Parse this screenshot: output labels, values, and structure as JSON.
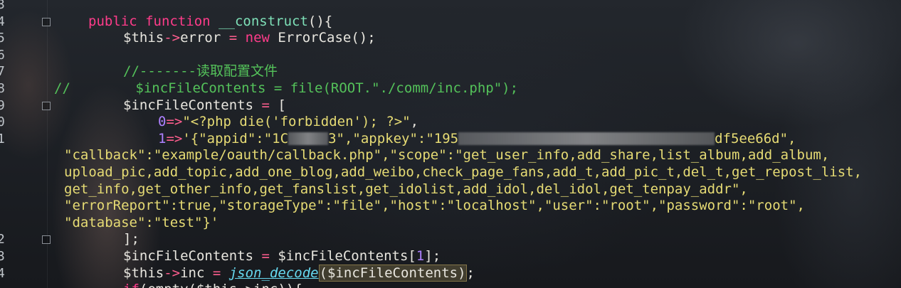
{
  "editor": {
    "lines": [
      {
        "no": "3",
        "parts": []
      },
      {
        "no": "4",
        "parts": [
          {
            "cls": "kw",
            "t": "public"
          },
          {
            "cls": "",
            "t": " "
          },
          {
            "cls": "kw",
            "t": "function"
          },
          {
            "cls": "",
            "t": " "
          },
          {
            "cls": "fn",
            "t": "__construct"
          },
          {
            "cls": "",
            "t": "(){"
          }
        ]
      },
      {
        "no": "5",
        "parts": [
          {
            "cls": "",
            "t": "$this"
          },
          {
            "cls": "op",
            "t": "->"
          },
          {
            "cls": "",
            "t": "error "
          },
          {
            "cls": "op",
            "t": "="
          },
          {
            "cls": "",
            "t": " "
          },
          {
            "cls": "kw",
            "t": "new"
          },
          {
            "cls": "",
            "t": " ErrorCase();"
          }
        ]
      },
      {
        "no": "6",
        "parts": []
      },
      {
        "no": "7",
        "parts": [
          {
            "cls": "cm",
            "t": "//-------读取配置文件"
          }
        ]
      },
      {
        "no": "8",
        "parts": [
          {
            "cls": "cm",
            "t": "//        $incFileContents = file(ROOT.\"./comm/inc.php\");"
          }
        ]
      },
      {
        "no": "9",
        "parts": [
          {
            "cls": "",
            "t": "$incFileContents "
          },
          {
            "cls": "op",
            "t": "="
          },
          {
            "cls": "",
            "t": " ["
          }
        ]
      },
      {
        "no": "0",
        "parts": [
          {
            "cls": "nm",
            "t": "0"
          },
          {
            "cls": "op",
            "t": "=>"
          },
          {
            "cls": "st",
            "t": "\"<?php die('forbidden'); ?>\""
          },
          {
            "cls": "",
            "t": ","
          }
        ]
      },
      {
        "no": "1",
        "parts": [
          {
            "cls": "nm",
            "t": "1"
          },
          {
            "cls": "op",
            "t": "=>"
          },
          {
            "cls": "st",
            "t": "'{\"appid\":\"1C"
          },
          {
            "cls": "blur",
            "t": ""
          },
          {
            "cls": "st",
            "t": "3\",\"appkey\":\"195"
          },
          {
            "cls": "blur wide",
            "t": ""
          },
          {
            "cls": "st",
            "t": "df5ee66d\","
          }
        ]
      },
      {
        "no": "",
        "parts": [
          {
            "cls": "st",
            "t": "\"callback\":\"example/oauth/callback.php\",\"scope\":\"get_user_info,add_share,list_album,add_album,"
          }
        ]
      },
      {
        "no": "",
        "parts": [
          {
            "cls": "st",
            "t": "upload_pic,add_topic,add_one_blog,add_weibo,check_page_fans,add_t,add_pic_t,del_t,get_repost_list,"
          }
        ]
      },
      {
        "no": "",
        "parts": [
          {
            "cls": "st",
            "t": "get_info,get_other_info,get_fanslist,get_idolist,add_idol,del_idol,get_tenpay_addr\","
          }
        ]
      },
      {
        "no": "",
        "parts": [
          {
            "cls": "st",
            "t": "\"errorReport\":true,\"storageType\":\"file\",\"host\":\"localhost\",\"user\":\"root\",\"password\":\"root\","
          }
        ]
      },
      {
        "no": "",
        "parts": [
          {
            "cls": "st",
            "t": "\"database\":\"test\"}'"
          }
        ]
      },
      {
        "no": "2",
        "parts": [
          {
            "cls": "",
            "t": "];"
          }
        ]
      },
      {
        "no": "3",
        "parts": [
          {
            "cls": "",
            "t": "$incFileContents "
          },
          {
            "cls": "op",
            "t": "="
          },
          {
            "cls": "",
            "t": " $incFileContents["
          },
          {
            "cls": "nm",
            "t": "1"
          },
          {
            "cls": "",
            "t": "];"
          }
        ]
      },
      {
        "no": "4",
        "parts": [
          {
            "cls": "",
            "t": "$this"
          },
          {
            "cls": "op",
            "t": "->"
          },
          {
            "cls": "",
            "t": "inc "
          },
          {
            "cls": "op",
            "t": "="
          },
          {
            "cls": "",
            "t": " "
          },
          {
            "cls": "call",
            "t": "json_decode"
          },
          {
            "cls": "hl",
            "t": "($incFileContents)"
          },
          {
            "cls": "",
            "t": ";"
          }
        ]
      },
      {
        "no": "",
        "parts": [
          {
            "cls": "kw",
            "t": "if"
          },
          {
            "cls": "",
            "t": "(empty($this->inc)){"
          }
        ]
      }
    ]
  }
}
